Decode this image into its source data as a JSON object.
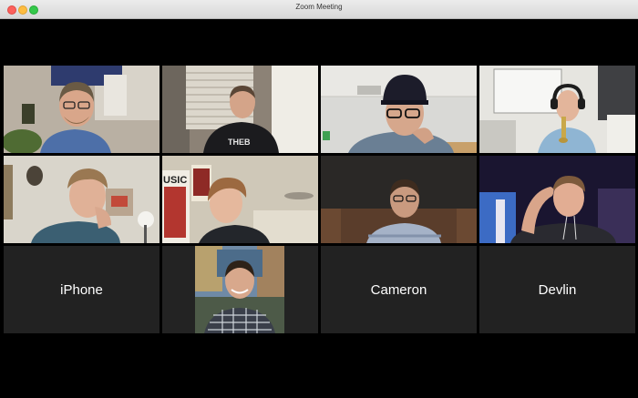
{
  "window": {
    "title": "Zoom Meeting",
    "traffic_lights": {
      "close": "#fc605c",
      "minimize": "#fdbc40",
      "maximize": "#34c84a"
    }
  },
  "accent": {
    "active_speaker_border": "#cfe07a"
  },
  "participants": [
    {
      "type": "video",
      "active": false
    },
    {
      "type": "video",
      "active": false,
      "shirt_text": "THEB"
    },
    {
      "type": "video",
      "active": false
    },
    {
      "type": "video",
      "active": true
    },
    {
      "type": "video",
      "active": false,
      "poster_text": "USIC"
    },
    {
      "type": "video",
      "active": false
    },
    {
      "type": "video",
      "active": false
    },
    {
      "type": "video",
      "active": false
    },
    {
      "type": "name",
      "name": "iPhone"
    },
    {
      "type": "photo",
      "active": false
    },
    {
      "type": "name",
      "name": "Cameron"
    },
    {
      "type": "name",
      "name": "Devlin"
    }
  ]
}
